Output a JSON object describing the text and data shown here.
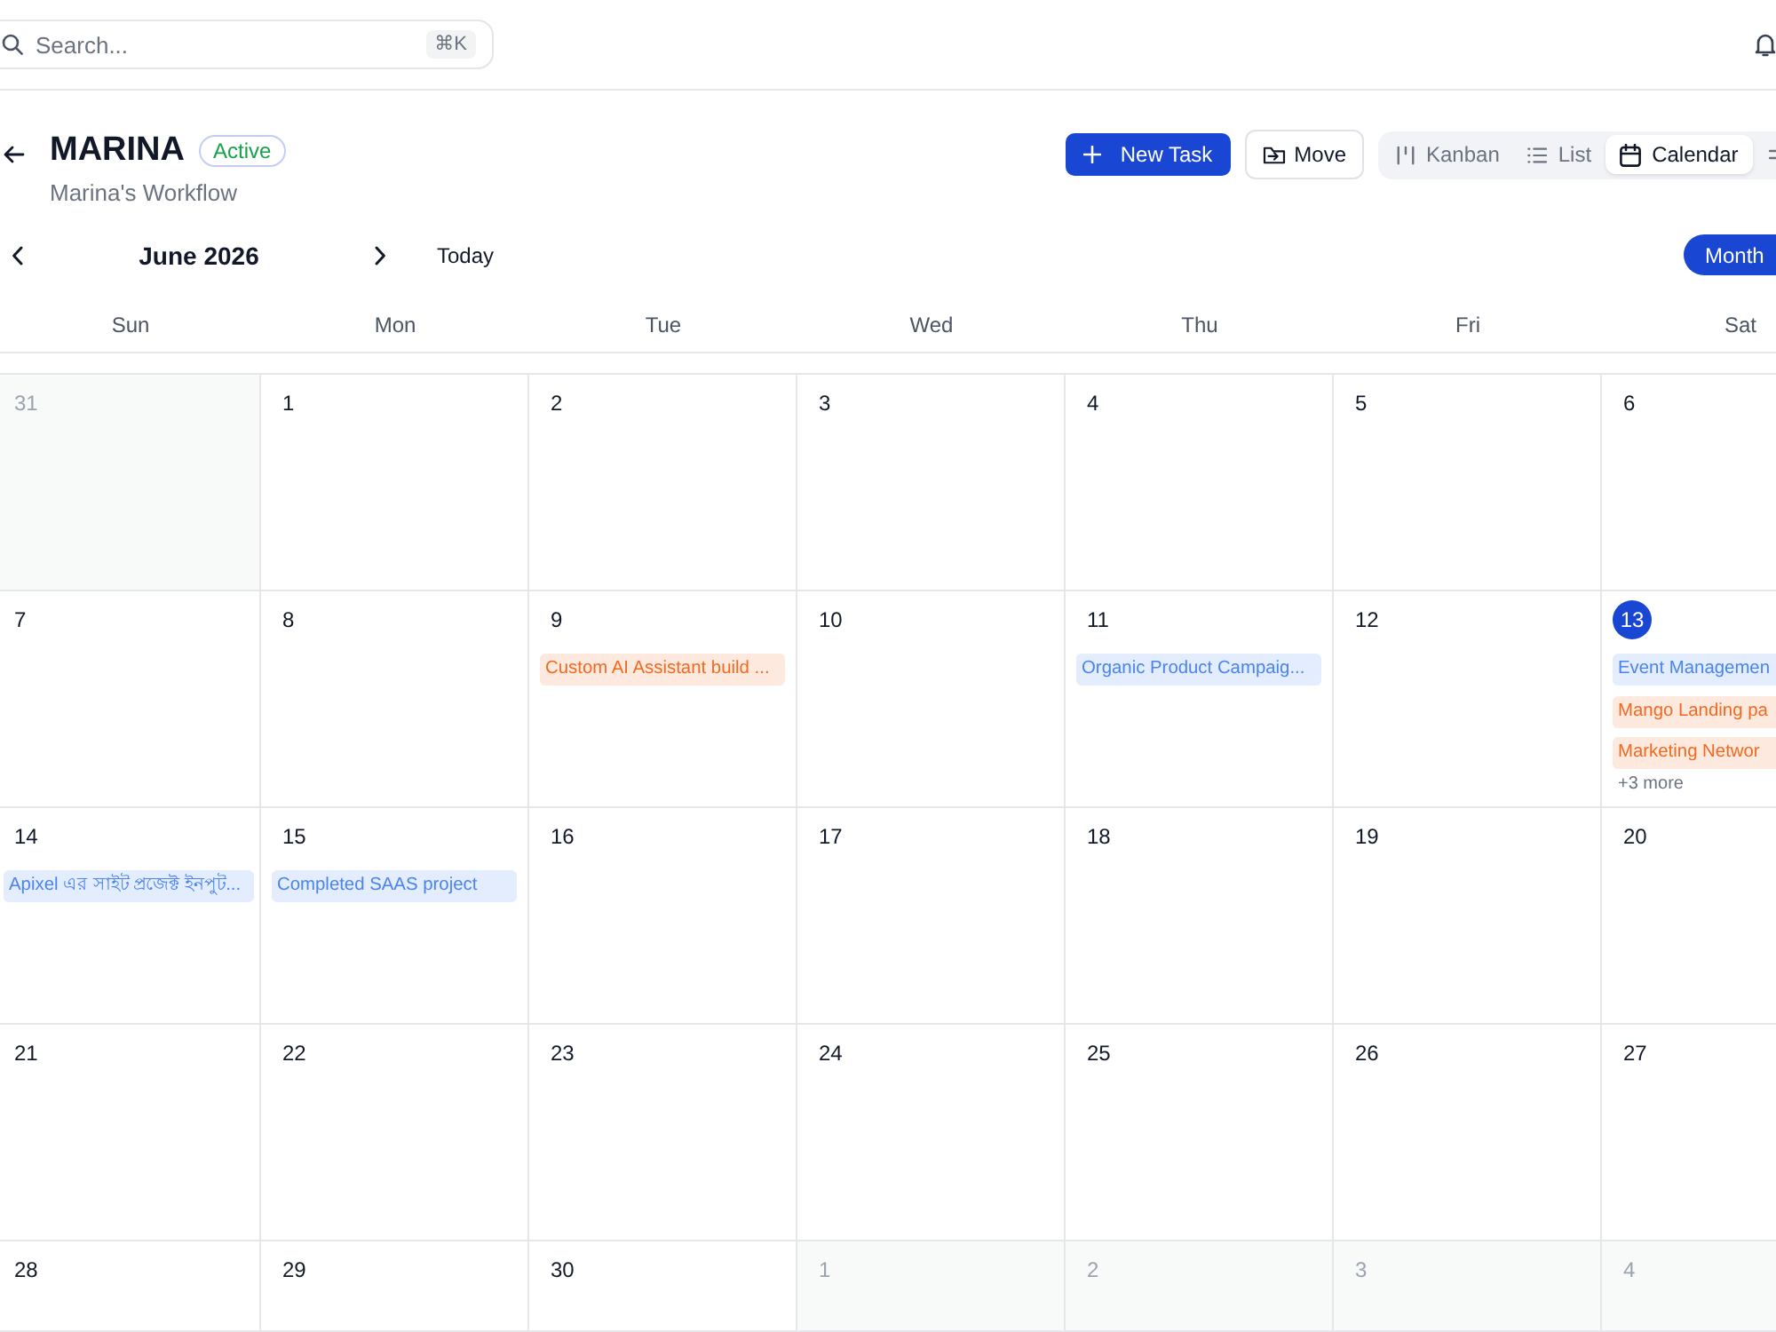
{
  "search": {
    "placeholder": "Search...",
    "shortcut": "⌘K"
  },
  "project": {
    "title": "MARINA",
    "status": "Active",
    "subtitle": "Marina's Workflow"
  },
  "actions": [
    {
      "kind": "create",
      "label": "New Task"
    },
    {
      "kind": "move",
      "label": "Move"
    }
  ],
  "views": [
    {
      "kind": "kanban",
      "label": "Kanban",
      "selected": false
    },
    {
      "kind": "list",
      "label": "List",
      "selected": false
    },
    {
      "kind": "calendar",
      "label": "Calendar",
      "selected": true
    }
  ],
  "calendar": {
    "month": "June 2026",
    "today_button": "Today",
    "view_mode": "Month",
    "weekdays": [
      "Sun",
      "Mon",
      "Tue",
      "Wed",
      "Thu",
      "Fri",
      "Sat"
    ],
    "weeks": [
      {
        "days": [
          {
            "date": "31",
            "outside": true,
            "today": false
          },
          {
            "date": "1",
            "outside": false,
            "today": false
          },
          {
            "date": "2",
            "outside": false,
            "today": false
          },
          {
            "date": "3",
            "outside": false,
            "today": false
          },
          {
            "date": "4",
            "outside": false,
            "today": false
          },
          {
            "date": "5",
            "outside": false,
            "today": false
          },
          {
            "date": "6",
            "outside": false,
            "today": false
          }
        ]
      },
      {
        "days": [
          {
            "date": "7",
            "outside": false,
            "today": false
          },
          {
            "date": "8",
            "outside": false,
            "today": false
          },
          {
            "date": "9",
            "outside": false,
            "today": false,
            "events": [
              {
                "title": "Custom AI Assistant build ...",
                "color": "#f26a21"
              }
            ]
          },
          {
            "date": "10",
            "outside": false,
            "today": false
          },
          {
            "date": "11",
            "outside": false,
            "today": false,
            "events": [
              {
                "title": "Organic Product Campaig...",
                "color": "#4a84ef"
              }
            ]
          },
          {
            "date": "12",
            "outside": false,
            "today": false
          },
          {
            "date": "13",
            "outside": false,
            "today": true,
            "events": [
              {
                "title": "Event Managemen",
                "color": "#4a84ef"
              },
              {
                "title": "Mango Landing pa",
                "color": "#f26a21"
              },
              {
                "title": "Marketing Networ",
                "color": "#f26a21"
              }
            ],
            "more": "+3 more"
          }
        ]
      },
      {
        "days": [
          {
            "date": "14",
            "outside": false,
            "today": false,
            "events": [
              {
                "title": "Apixel এর সাইট প্রজেক্ট ইনপুট...",
                "color": "#4a84ef"
              }
            ]
          },
          {
            "date": "15",
            "outside": false,
            "today": false,
            "events": [
              {
                "title": "Completed SAAS project",
                "color": "#4a84ef"
              }
            ]
          },
          {
            "date": "16",
            "outside": false,
            "today": false
          },
          {
            "date": "17",
            "outside": false,
            "today": false
          },
          {
            "date": "18",
            "outside": false,
            "today": false
          },
          {
            "date": "19",
            "outside": false,
            "today": false
          },
          {
            "date": "20",
            "outside": false,
            "today": false
          }
        ]
      },
      {
        "days": [
          {
            "date": "21",
            "outside": false,
            "today": false
          },
          {
            "date": "22",
            "outside": false,
            "today": false
          },
          {
            "date": "23",
            "outside": false,
            "today": false
          },
          {
            "date": "24",
            "outside": false,
            "today": false
          },
          {
            "date": "25",
            "outside": false,
            "today": false
          },
          {
            "date": "26",
            "outside": false,
            "today": false
          },
          {
            "date": "27",
            "outside": false,
            "today": false
          }
        ]
      },
      {
        "days": [
          {
            "date": "28",
            "outside": false,
            "today": false
          },
          {
            "date": "29",
            "outside": false,
            "today": false
          },
          {
            "date": "30",
            "outside": false,
            "today": false
          },
          {
            "date": "1",
            "outside": true,
            "today": false
          },
          {
            "date": "2",
            "outside": true,
            "today": false
          },
          {
            "date": "3",
            "outside": true,
            "today": false
          },
          {
            "date": "4",
            "outside": true,
            "today": false
          }
        ]
      }
    ]
  }
}
